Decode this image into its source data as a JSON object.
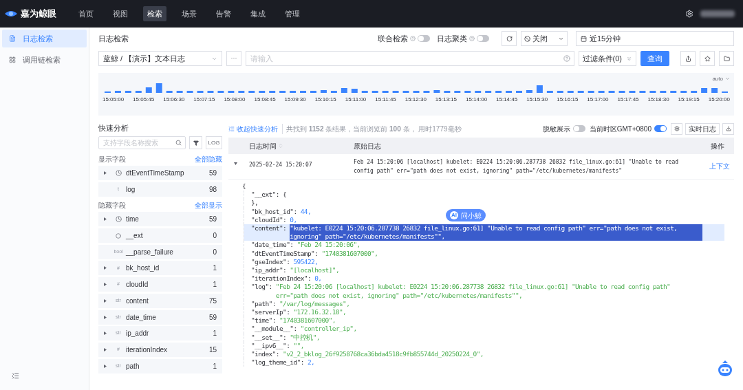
{
  "brand": {
    "name": "嘉为鲸眼"
  },
  "nav": [
    {
      "label": "首页",
      "selected": false
    },
    {
      "label": "视图",
      "selected": false
    },
    {
      "label": "检索",
      "selected": true
    },
    {
      "label": "场景",
      "selected": false
    },
    {
      "label": "告警",
      "selected": false
    },
    {
      "label": "集成",
      "selected": false
    },
    {
      "label": "管理",
      "selected": false
    }
  ],
  "sidebar": {
    "items": [
      {
        "label": "日志检索",
        "selected": true
      },
      {
        "label": "调用链检索",
        "selected": false
      }
    ]
  },
  "page_title": "日志检索",
  "toggles": [
    {
      "label": "联合检索",
      "on": false
    },
    {
      "label": "日志聚类",
      "on": false
    }
  ],
  "refresh": {
    "value": "关闭"
  },
  "time_range": {
    "value": "近15分钟"
  },
  "index_select": {
    "value": "蓝鲸 / 【演示】文本日志"
  },
  "more_button": "···",
  "query": {
    "placeholder": "请输入"
  },
  "filter_button": "过滤条件(0)",
  "search_button": "查询",
  "histogram": {
    "interval": "auto",
    "x_labels": [
      "15:05:00",
      "15:05:45",
      "15:06:30",
      "15:07:15",
      "15:08:00",
      "15:08:45",
      "15:09:30",
      "15:10:15",
      "15:11:00",
      "15:11:45",
      "15:12:30",
      "15:13:15",
      "15:14:00",
      "15:14:45",
      "15:15:30",
      "15:16:15",
      "15:17:00",
      "15:17:45",
      "15:18:30",
      "15:19:15",
      "15:20:00"
    ]
  },
  "quick_analysis": {
    "title": "快速分析",
    "search": {
      "placeholder": "支持字段名称搜索"
    },
    "log_button": "LOG",
    "groups": [
      {
        "title": "显示字段",
        "action": "全部隐藏",
        "fields": [
          {
            "name": "dtEventTimeStamp",
            "count": "59",
            "kind": "time",
            "expandable": true
          },
          {
            "name": "log",
            "count": "98",
            "kind": "text",
            "type_label": "t",
            "expandable": false
          }
        ]
      },
      {
        "title": "隐藏字段",
        "action": "全部显示",
        "fields": [
          {
            "name": "time",
            "count": "59",
            "kind": "time",
            "expandable": true
          },
          {
            "name": "__ext",
            "count": "0",
            "kind": "object",
            "expandable": false
          },
          {
            "name": "__parse_failure",
            "count": "0",
            "kind": "text",
            "type_label": "bool",
            "expandable": false
          },
          {
            "name": "bk_host_id",
            "count": "1",
            "kind": "text",
            "type_label": "#",
            "expandable": true
          },
          {
            "name": "cloudId",
            "count": "1",
            "kind": "text",
            "type_label": "#",
            "expandable": true
          },
          {
            "name": "content",
            "count": "75",
            "kind": "text",
            "type_label": "str",
            "expandable": true
          },
          {
            "name": "date_time",
            "count": "59",
            "kind": "text",
            "type_label": "str",
            "expandable": true
          },
          {
            "name": "ip_addr",
            "count": "1",
            "kind": "text",
            "type_label": "str",
            "expandable": true
          },
          {
            "name": "iterationIndex",
            "count": "15",
            "kind": "text",
            "type_label": "#",
            "expandable": true
          },
          {
            "name": "path",
            "count": "1",
            "kind": "text",
            "type_label": "str",
            "expandable": true
          }
        ]
      }
    ]
  },
  "results": {
    "collapse_link": "收起快速分析",
    "summary": "共找到 **1152** 条结果，当前浏览前 **100** 条， 用时1779毫秒",
    "toggles": [
      {
        "label": "脱敏展示",
        "on": false
      },
      {
        "label": "当前时区GMT+0800",
        "on": true
      }
    ],
    "realtime_button": "实时日志",
    "columns": [
      "日志时间",
      "原始日志",
      "操作"
    ],
    "rows": [
      {
        "time": "2025-02-24 15:20:07",
        "log": "Feb 24 15:20:06 [localhost] kubelet: E0224 15:20:06.287738   26832 file_linux.go:61] \"Unable to read config path\" err=\"path does not exist, ignoring\" path=\"/etc/kubernetes/manifests\"",
        "action": "上下文",
        "expanded": true
      }
    ],
    "ai_button": {
      "badge": "AI",
      "label": "问小鲸"
    },
    "json_lines": [
      {
        "value": "{",
        "kind": "plain",
        "selected": false
      },
      {
        "key": "\"__ext\": ",
        "value": "{",
        "kind": "plain",
        "selected": false
      },
      {
        "value": "},",
        "kind": "plain",
        "selected": false
      },
      {
        "key": "\"bk_host_id\": ",
        "value": "44,",
        "kind": "number",
        "selected": false
      },
      {
        "key": "\"cloudId\": ",
        "value": "0,",
        "kind": "number",
        "selected": false
      },
      {
        "key": "\"content\": ",
        "value": "\"kubelet: E0224 15:20:06.287738   26832 file_linux.go:61] \"Unable to read config path\" err=\"path does not exist, ignoring\" path=\"/etc/kubernetes/manifests\"\",",
        "kind": "string",
        "selected": true
      },
      {
        "key": "\"date_time\": ",
        "value": "\"Feb 24 15:20:06\",",
        "kind": "string",
        "selected": false
      },
      {
        "key": "\"dtEventTimeStamp\": ",
        "value": "\"1740381607000\",",
        "kind": "string",
        "selected": false
      },
      {
        "key": "\"gseIndex\": ",
        "value": "595422,",
        "kind": "number",
        "selected": false
      },
      {
        "key": "\"ip_addr\": ",
        "value": "\"[localhost]\",",
        "kind": "string",
        "selected": false
      },
      {
        "key": "\"iterationIndex\": ",
        "value": "0,",
        "kind": "number",
        "selected": false
      },
      {
        "key": "\"log\": ",
        "value": "\"Feb 24 15:20:06 [localhost] kubelet: E0224 15:20:06.287738   26832 file_linux.go:61] \"Unable to read config path\" err=\"path does not exist, ignoring\" path=\"/etc/kubernetes/manifests\"\",",
        "kind": "string",
        "selected": false
      },
      {
        "key": "\"path\": ",
        "value": "\"/var/log/messages\",",
        "kind": "string",
        "selected": false
      },
      {
        "key": "\"serverIp\": ",
        "value": "\"172.16.32.18\",",
        "kind": "string",
        "selected": false
      },
      {
        "key": "\"time\": ",
        "value": "\"1740381607000\",",
        "kind": "string",
        "selected": false
      },
      {
        "key": "\"__module__\": ",
        "value": "\"controller_ip\",",
        "kind": "string",
        "selected": false
      },
      {
        "key": "\"__set__\": ",
        "value": "\"中控机\",",
        "kind": "string",
        "selected": false
      },
      {
        "key": "\"__ipv6__\": ",
        "value": "\"\",",
        "kind": "string",
        "selected": false
      },
      {
        "key": "\"index\": ",
        "value": "\"v2_2_bklog_26f9258768ca36bda4518c9fb855744d_20250224_0\",",
        "kind": "string",
        "selected": false
      },
      {
        "key": "\"log_theme_id\": ",
        "value": "2,",
        "kind": "number",
        "selected": false
      }
    ]
  }
}
